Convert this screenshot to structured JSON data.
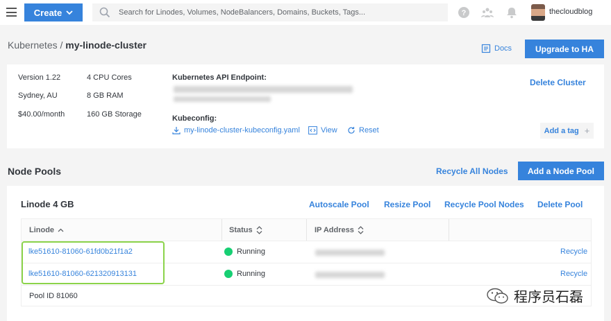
{
  "topbar": {
    "create_label": "Create",
    "search_placeholder": "Search for Linodes, Volumes, NodeBalancers, Domains, Buckets, Tags...",
    "username": "thecloudblog"
  },
  "breadcrumb": {
    "parent": "Kubernetes",
    "separator": "/",
    "current": "my-linode-cluster"
  },
  "header_actions": {
    "docs_label": "Docs",
    "upgrade_label": "Upgrade to HA"
  },
  "summary": {
    "version": "Version 1.22",
    "region": "Sydney, AU",
    "price": "$40.00/month",
    "cpu": "4 CPU Cores",
    "ram": "8 GB RAM",
    "storage": "160 GB Storage",
    "api_endpoint_label": "Kubernetes API Endpoint:",
    "kubeconfig_label": "Kubeconfig:",
    "kubeconfig_file": "my-linode-cluster-kubeconfig.yaml",
    "view_label": "View",
    "reset_label": "Reset",
    "delete_label": "Delete Cluster",
    "add_tag_label": "Add a tag"
  },
  "node_pools": {
    "title": "Node Pools",
    "recycle_all_label": "Recycle All Nodes",
    "add_pool_label": "Add a Node Pool",
    "pool": {
      "title": "Linode 4 GB",
      "actions": [
        "Autoscale Pool",
        "Resize Pool",
        "Recycle Pool Nodes",
        "Delete Pool"
      ],
      "columns": [
        "Linode",
        "Status",
        "IP Address"
      ],
      "rows": [
        {
          "linode": "lke51610-81060-61fd0b21f1a2",
          "status": "Running",
          "action": "Recycle"
        },
        {
          "linode": "lke51610-81060-621320913131",
          "status": "Running",
          "action": "Recycle"
        }
      ],
      "pool_id": "Pool ID 81060"
    }
  },
  "watermark": "程序员石磊",
  "colors": {
    "accent": "#3683dc",
    "running": "#17cf73",
    "highlight": "#8bd34a"
  }
}
